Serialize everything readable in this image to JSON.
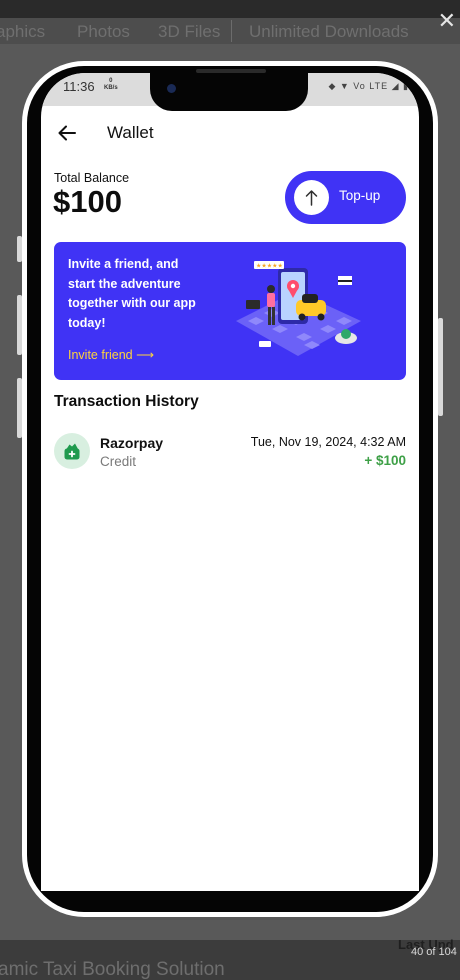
{
  "backdrop": {
    "tabs": [
      "aphics",
      "Photos",
      "3D Files",
      "Unlimited Downloads"
    ],
    "close_glyph": "✕",
    "bottom_title": "amic Taxi Booking Solution",
    "last_updated_label": "Last Upd",
    "pager": "40 of 104"
  },
  "status_bar": {
    "time": "11:36",
    "speed_value": "0",
    "speed_unit": "KB/s",
    "icons": "◆ ▼ Vo LTE ◢ ▮"
  },
  "header": {
    "back_icon": "arrow-left-icon",
    "title": "Wallet"
  },
  "balance": {
    "label": "Total Balance",
    "amount": "$100"
  },
  "topup": {
    "icon": "arrow-up-icon",
    "label": "Top-up"
  },
  "invite": {
    "text": "Invite a friend, and start the adventure together with our app today!",
    "link": "Invite friend ⟶"
  },
  "transactions": {
    "title": "Transaction History",
    "items": [
      {
        "icon": "wallet-icon",
        "name": "Razorpay",
        "type": "Credit",
        "date": "Tue, Nov 19, 2024, 4:32 AM",
        "amount": "+ $100"
      }
    ]
  },
  "colors": {
    "accent": "#4033f5",
    "link_yellow": "#ffd43b",
    "credit_green": "#3ea047"
  }
}
